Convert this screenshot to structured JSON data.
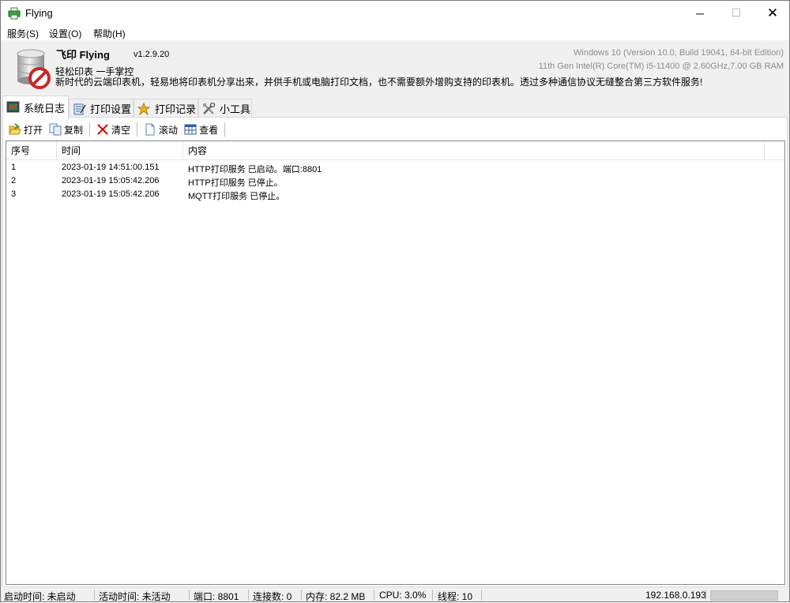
{
  "window": {
    "title": "Flying",
    "min_glyph": "─",
    "max_glyph": "☐",
    "close_glyph": "✕"
  },
  "menu": [
    {
      "label": "服务(S)"
    },
    {
      "label": "设置(O)"
    },
    {
      "label": "帮助(H)"
    }
  ],
  "banner": {
    "app_name": "飞印 Flying",
    "version": "v1.2.9.20",
    "slogan": "轻松印表 一手掌控",
    "description": "新时代的云端印表机，轻易地将印表机分享出来，并供手机或电脑打印文档，也不需要额外增购支持的印表机。透过多种通信协议无缝整合第三方软件服务!",
    "os_info": "Windows 10 (Version 10.0, Build 19041, 64-bit Edition)",
    "hw_info": "11th Gen Intel(R) Core(TM) i5-11400 @ 2.60GHz,7.00 GB RAM"
  },
  "tabs": [
    {
      "label": "系统日志",
      "icon": "log-icon",
      "active": true
    },
    {
      "label": "打印设置",
      "icon": "settings-icon",
      "active": false
    },
    {
      "label": "打印记录",
      "icon": "record-icon",
      "active": false
    },
    {
      "label": "小工具",
      "icon": "tools-icon",
      "active": false
    }
  ],
  "toolbar": {
    "open": "打开",
    "copy": "复制",
    "clear": "清空",
    "scroll": "滚动",
    "view": "查看"
  },
  "log_table": {
    "columns": [
      "序号",
      "时间",
      "内容"
    ],
    "rows": [
      {
        "index": "1",
        "time": "2023-01-19 14:51:00.151",
        "content": "HTTP打印服务 已启动。端口:8801"
      },
      {
        "index": "2",
        "time": "2023-01-19 15:05:42.206",
        "content": "HTTP打印服务 已停止。"
      },
      {
        "index": "3",
        "time": "2023-01-19 15:05:42.206",
        "content": "MQTT打印服务 已停止。"
      }
    ]
  },
  "status": {
    "start_time": "启动时间: 未启动",
    "active_time": "活动时间: 未活动",
    "port": "端口: 8801",
    "connections": "连接数: 0",
    "memory": "内存: 82.2 MB",
    "cpu": "CPU: 3.0%",
    "threads": "线程: 10",
    "ip": "192.168.0.193",
    "progress": 0
  },
  "colors": {
    "accent_red": "#d40000",
    "progress_green": "#06b025"
  }
}
